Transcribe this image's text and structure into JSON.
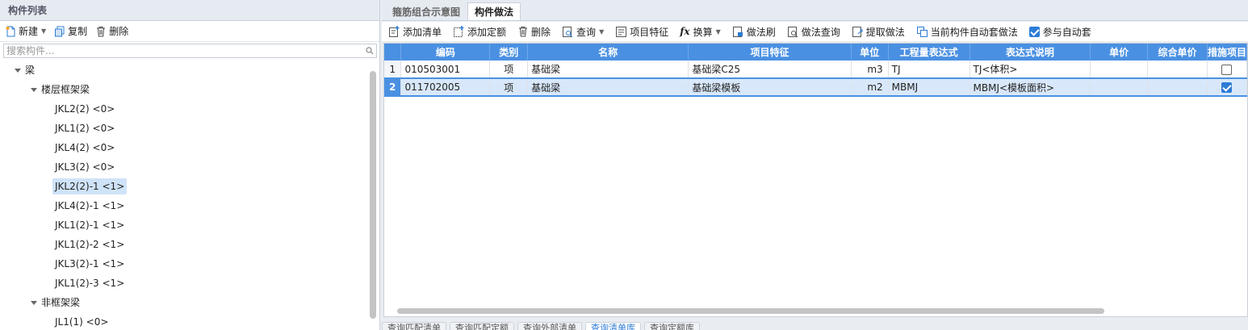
{
  "left_panel": {
    "title": "构件列表",
    "toolbar": {
      "new_label": "新建",
      "copy_label": "复制",
      "delete_label": "删除"
    },
    "search_placeholder": "搜索构件...",
    "tree": {
      "root": "梁",
      "groups": [
        {
          "label": "楼层框架梁",
          "items": [
            "JKL2(2) <0>",
            "JKL1(2) <0>",
            "JKL4(2) <0>",
            "JKL3(2) <0>",
            "JKL2(2)-1 <1>",
            "JKL4(2)-1 <1>",
            "JKL1(2)-1 <1>",
            "JKL1(2)-2 <1>",
            "JKL3(2)-1 <1>",
            "JKL1(2)-3 <1>"
          ]
        },
        {
          "label": "非框架梁",
          "items": [
            "JL1(1) <0>"
          ]
        }
      ],
      "selected_item": "JKL2(2)-1 <1>"
    }
  },
  "right_panel": {
    "tabs": [
      "箍筋组合示意图",
      "构件做法"
    ],
    "active_tab": "构件做法",
    "toolbar": {
      "add_list": "添加清单",
      "add_quota": "添加定额",
      "delete": "删除",
      "query": "查询",
      "item_feature": "项目特征",
      "convert": "换算",
      "method_brush": "做法刷",
      "method_query": "做法查询",
      "extract_method": "提取做法",
      "auto_apply": "当前构件自动套做法",
      "participate_auto": "参与自动套"
    },
    "participate_auto_checked": true,
    "grid": {
      "columns": [
        "",
        "编码",
        "类别",
        "名称",
        "项目特征",
        "单位",
        "工程量表达式",
        "表达式说明",
        "单价",
        "综合单价",
        "措施项目"
      ],
      "rows": [
        {
          "no": "1",
          "code": "010503001",
          "type": "项",
          "name": "基础梁",
          "feature": "基础梁C25",
          "unit": "m3",
          "expr": "TJ",
          "expr_desc": "TJ<体积>",
          "price": "",
          "total_price": "",
          "measure": false
        },
        {
          "no": "2",
          "code": "011702005",
          "type": "项",
          "name": "基础梁",
          "feature": "基础梁模板",
          "unit": "m2",
          "expr": "MBMJ",
          "expr_desc": "MBMJ<模板面积>",
          "price": "",
          "total_price": "",
          "measure": true
        }
      ],
      "selected_row": 2
    },
    "bottom_tabs": [
      "查询匹配清单",
      "查询匹配定额",
      "查询外部清单",
      "查询清单库",
      "查询定额库"
    ],
    "active_bottom_tab": "查询清单库"
  },
  "colors": {
    "accent": "#4a90e2",
    "selected_row": "#d8e8fa",
    "selected_tree": "#cfe3f8"
  }
}
